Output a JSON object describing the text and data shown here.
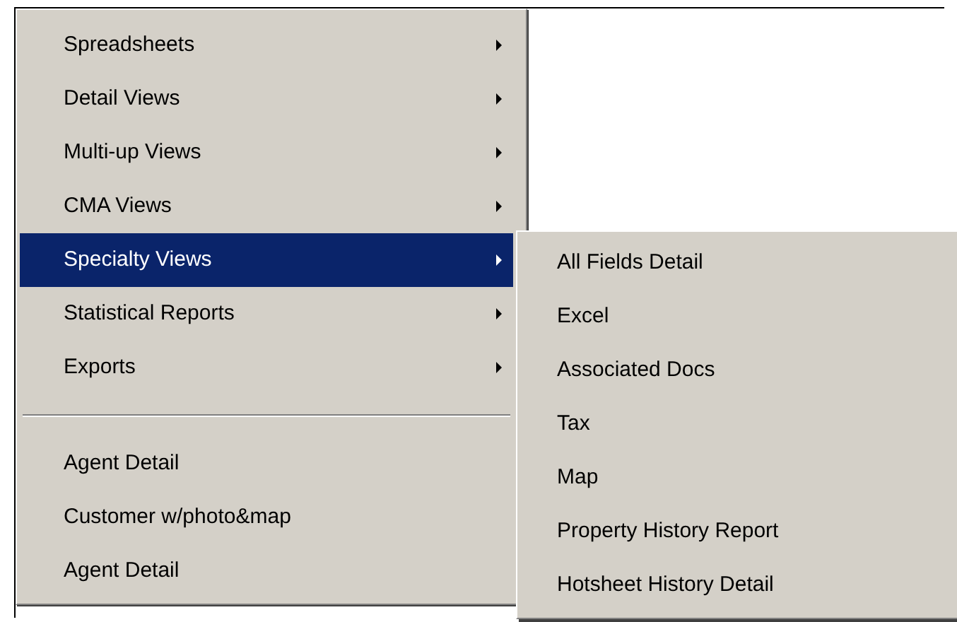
{
  "menu": {
    "items": [
      {
        "kind": "item",
        "label": "Spreadsheets",
        "submenu": true,
        "selected": false
      },
      {
        "kind": "item",
        "label": "Detail Views",
        "submenu": true,
        "selected": false
      },
      {
        "kind": "item",
        "label": "Multi-up Views",
        "submenu": true,
        "selected": false
      },
      {
        "kind": "item",
        "label": "CMA Views",
        "submenu": true,
        "selected": false
      },
      {
        "kind": "item",
        "label": "Specialty Views",
        "submenu": true,
        "selected": true
      },
      {
        "kind": "item",
        "label": "Statistical Reports",
        "submenu": true,
        "selected": false
      },
      {
        "kind": "item",
        "label": "Exports",
        "submenu": true,
        "selected": false
      },
      {
        "kind": "separator"
      },
      {
        "kind": "item",
        "label": "Agent Detail",
        "submenu": false,
        "selected": false
      },
      {
        "kind": "item",
        "label": "Customer w/photo&map",
        "submenu": false,
        "selected": false
      },
      {
        "kind": "item",
        "label": "Agent Detail",
        "submenu": false,
        "selected": false
      }
    ]
  },
  "submenu": {
    "items": [
      {
        "label": "All Fields Detail"
      },
      {
        "label": "Excel"
      },
      {
        "label": "Associated Docs"
      },
      {
        "label": "Tax"
      },
      {
        "label": "Map"
      },
      {
        "label": "Property History Report"
      },
      {
        "label": "Hotsheet History Detail"
      }
    ]
  }
}
